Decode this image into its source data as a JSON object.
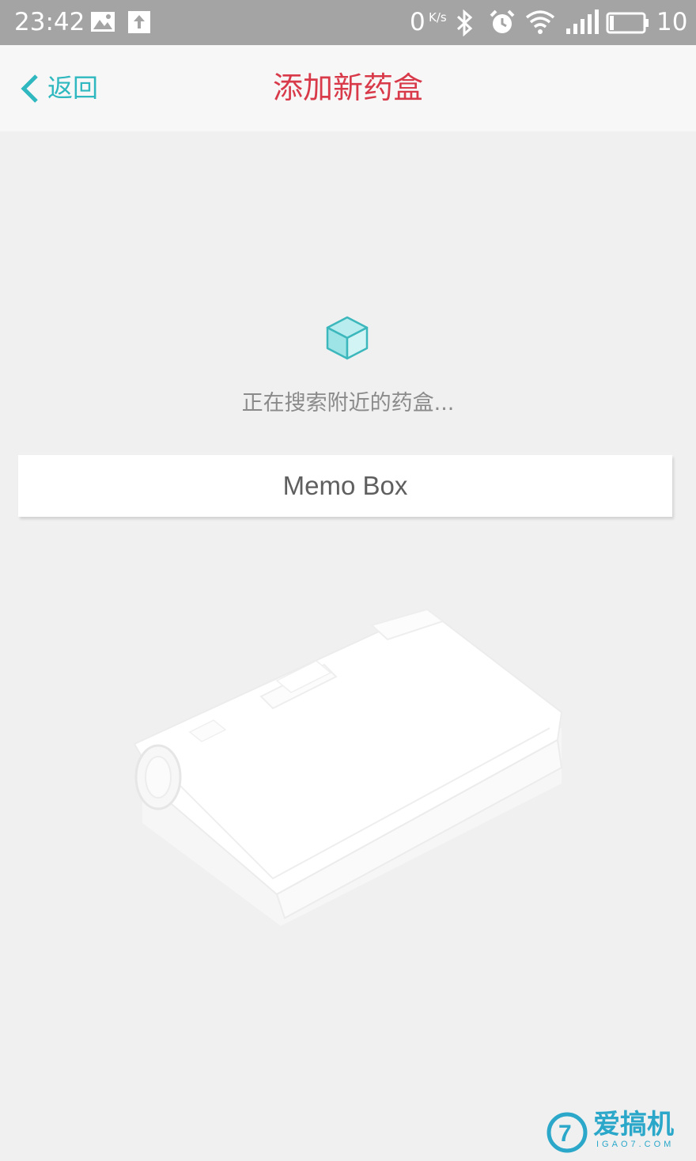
{
  "status_bar": {
    "time": "23:42",
    "net_speed": "0",
    "net_speed_unit": "K/s",
    "battery": "10",
    "icons": [
      "image-icon",
      "upload-icon",
      "bluetooth-icon",
      "alarm-icon",
      "wifi-icon",
      "signal-icon",
      "battery-icon"
    ]
  },
  "nav": {
    "back_label": "返回",
    "title": "添加新药盒"
  },
  "search": {
    "status_text": "正在搜索附近的药盒..."
  },
  "devices": [
    {
      "name": "Memo Box"
    }
  ],
  "watermark": {
    "text": "爱搞机",
    "sub": "IGAO7.COM"
  },
  "colors": {
    "accent": "#2fb8bf",
    "title": "#d83a4a",
    "status_bar": "#a4a4a4",
    "background": "#f0f0f0"
  }
}
